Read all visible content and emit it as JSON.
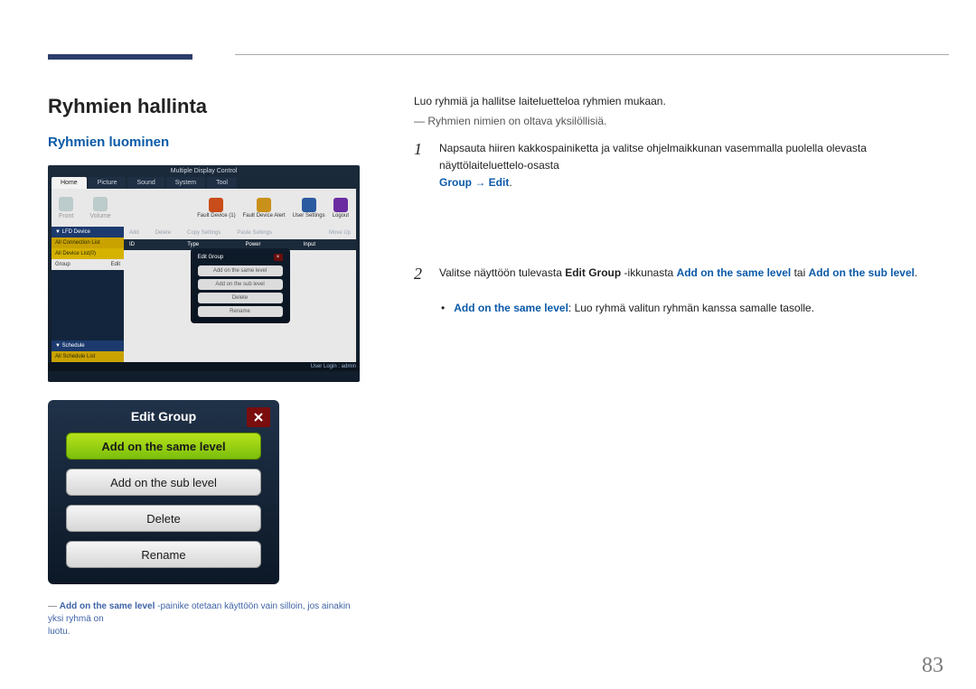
{
  "page_number": "83",
  "heading_h1": "Ryhmien hallinta",
  "heading_h2": "Ryhmien luominen",
  "mdc": {
    "window_title": "Multiple Display Control",
    "tabs": [
      "Home",
      "Picture",
      "Sound",
      "System",
      "Tool"
    ],
    "toolbar_left": [
      "Front",
      "Volume"
    ],
    "toolbar_right": [
      "Fault Device (1)",
      "Fault Device Alert",
      "User Settings",
      "Logout"
    ],
    "side_lfd": "▼ LFD Device",
    "side_conn": "All Connection List",
    "side_all_devices": "All Device List(0)",
    "side_group": "Group",
    "side_group_edit": "Edit",
    "sched_head": "▼ Schedule",
    "sched_list": "All Schedule List",
    "main_head_bar": [
      "Add",
      "Delete",
      "Copy Settings",
      "Paste Settings",
      "Move Up"
    ],
    "main_table_head": [
      "ID",
      "Type",
      "Power",
      "Input"
    ],
    "popup_title": "Edit Group",
    "popup_buttons": [
      "Add on the same level",
      "Add on the sub level",
      "Delete",
      "Rename"
    ],
    "footer": "User Login : admin"
  },
  "edit_dialog": {
    "title": "Edit Group",
    "buttons": [
      "Add on the same level",
      "Add on the sub level",
      "Delete",
      "Rename"
    ]
  },
  "left_footnote_lead": "Add on the same level",
  "left_footnote_rest": " -painike otetaan käyttöön vain silloin, jos ainakin yksi ryhmä on",
  "left_footnote_line2": "luotu.",
  "right": {
    "intro": "Luo ryhmiä ja hallitse laiteluetteloa ryhmien mukaan.",
    "dashnote": "Ryhmien nimien on oltava yksilöllisiä.",
    "step1_num": "1",
    "step1_text_a": "Napsauta hiiren kakkospainiketta ja valitse ohjelmaikkunan vasemmalla puolella olevasta näyttölaiteluettelo-osasta ",
    "step1_blue": "Group → Edit",
    "step1_dot": ".",
    "step2_num": "2",
    "step2_a": "Valitse näyttöön tulevasta ",
    "step2_bold1": "Edit Group",
    "step2_b": " -ikkunasta ",
    "step2_blue1": "Add on the same level",
    "step2_c": " tai ",
    "step2_blue2": "Add on the sub level",
    "step2_dot": ".",
    "bullet_blue": "Add on the same level",
    "bullet_rest": ": Luo ryhmä valitun ryhmän kanssa samalle tasolle."
  }
}
